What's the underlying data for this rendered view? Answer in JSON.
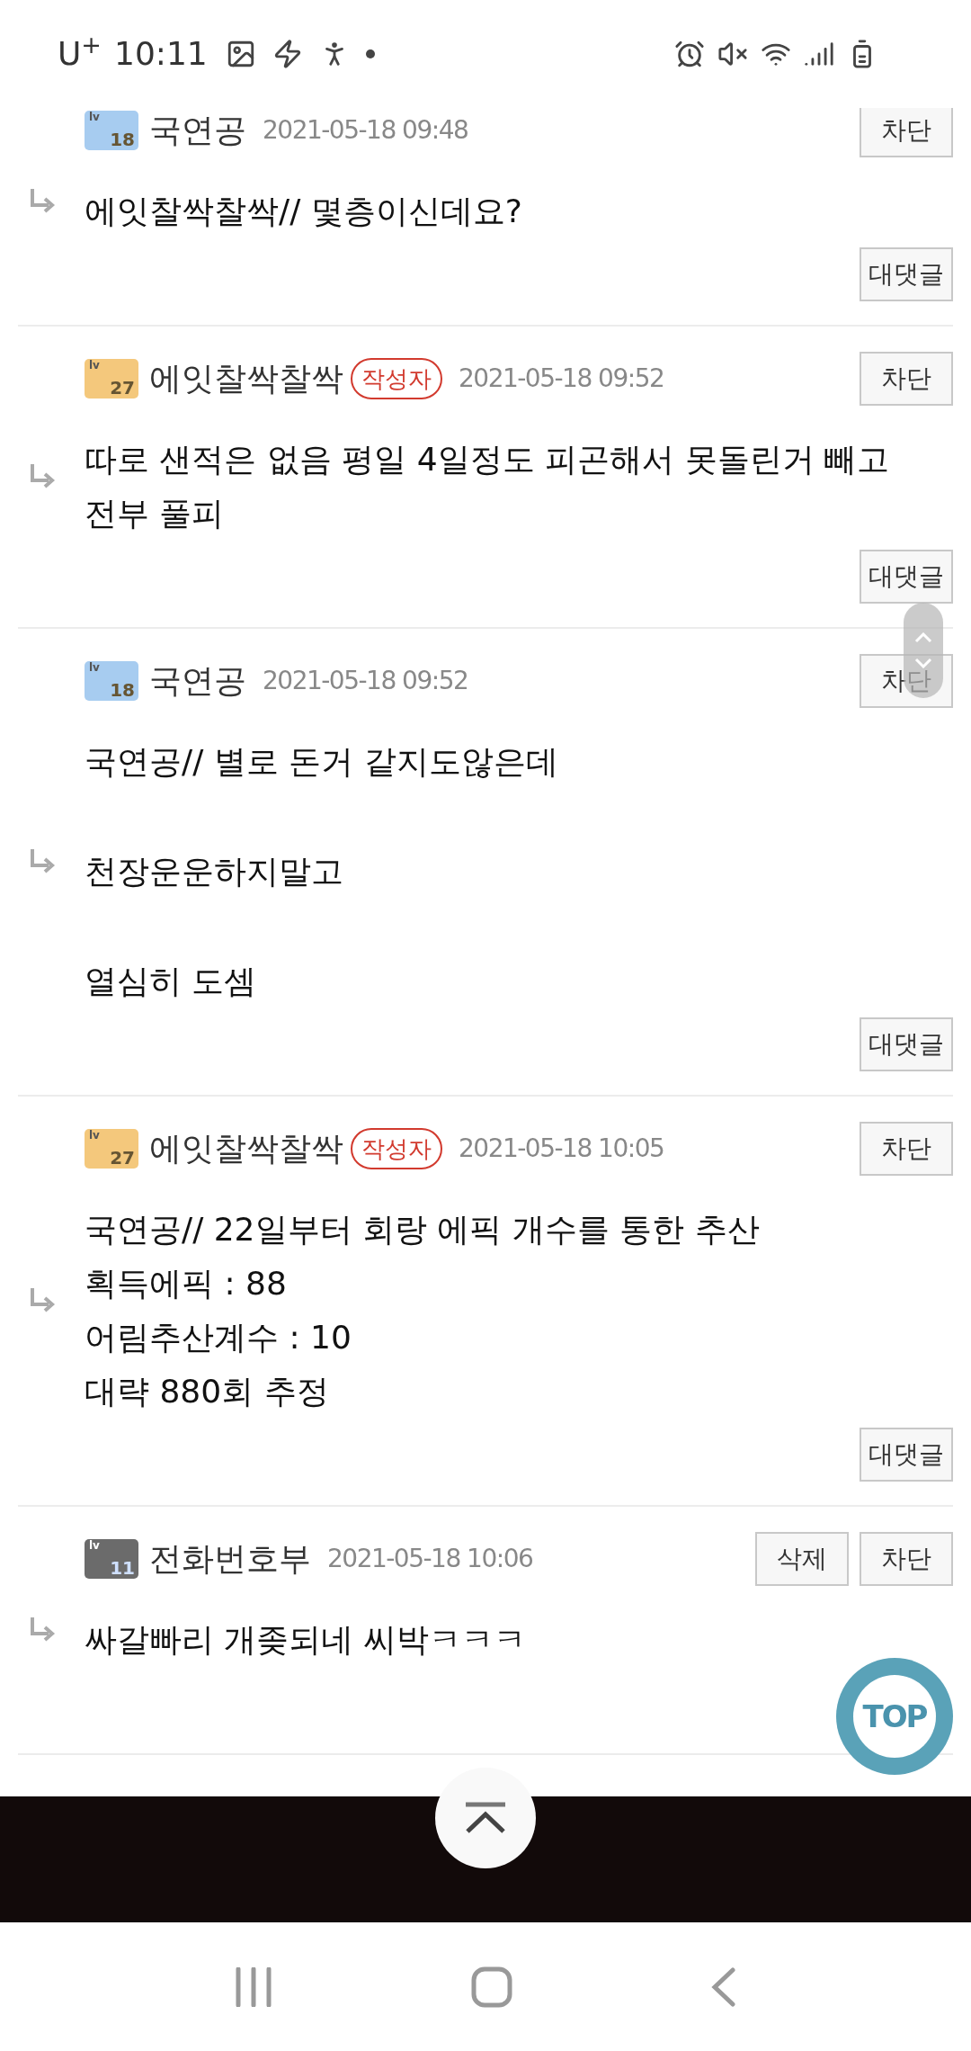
{
  "status_bar": {
    "carrier": "U$^{+}$",
    "time": "10:11"
  },
  "comments": [
    {
      "author": "국연공",
      "rank_prefix": "lv",
      "rank": "18",
      "color": "#a7ccf0",
      "date": "2021-05-18 09:48",
      "actions": [
        "차단"
      ],
      "body": [
        [
          "에잇찰싹찰싹// 몇층이신데요?"
        ]
      ],
      "reply_button": "대댓글"
    },
    {
      "author": "에잇찰싹찰싹",
      "rank_prefix": "lv",
      "rank": "27",
      "color": "#f4c87c",
      "writer_tag": "작성자",
      "date": "2021-05-18 09:52",
      "actions": [
        "차단"
      ],
      "body": [
        [
          "따로 샌적은 없음 평일 4일정도 피곤해서 못돌린거 빼고 전부 풀피"
        ]
      ],
      "reply_button": "대댓글"
    },
    {
      "author": "국연공",
      "rank_prefix": "lv",
      "rank": "18",
      "color": "#a7ccf0",
      "date": "2021-05-18 09:52",
      "actions": [
        "차단"
      ],
      "body": [
        [
          "국연공// 별로 돈거 같지도않은데"
        ],
        [
          "천장운운하지말고"
        ],
        [
          "열심히 도셈"
        ]
      ],
      "reply_button": "대댓글"
    },
    {
      "author": "에잇찰싹찰싹",
      "rank_prefix": "lv",
      "rank": "27",
      "color": "#f4c87c",
      "writer_tag": "작성자",
      "date": "2021-05-18 10:05",
      "actions": [
        "차단"
      ],
      "body": [
        [
          "국연공// 22일부터 회랑 에픽 개수를 통한 추산",
          "획득에픽 : 88",
          "어림추산계수 : 10",
          "대략 880회 추정"
        ]
      ],
      "reply_button": "대댓글"
    },
    {
      "author": "전화번호부",
      "rank_prefix": "lv",
      "rank": "11",
      "color": "#6b6b6b",
      "date": "2021-05-18 10:06",
      "actions": [
        "삭제",
        "차단"
      ],
      "body": [
        [
          "싸갈빠리 개좆되네 씨박ㅋㅋㅋ"
        ]
      ]
    }
  ],
  "top_button": {
    "label": "TOP"
  }
}
